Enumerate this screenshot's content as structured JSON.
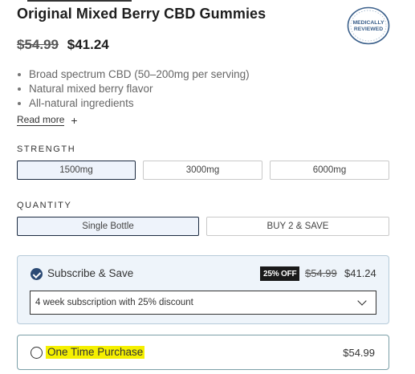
{
  "product": {
    "title": "Original Mixed Berry CBD Gummies",
    "price_original": "$54.99",
    "price_sale": "$41.24",
    "badge_text_line1": "MEDICALLY",
    "badge_text_line2": "REVIEWED",
    "features": [
      "Broad spectrum CBD (50–200mg per serving)",
      "Natural mixed berry flavor",
      "All-natural ingredients"
    ],
    "read_more_label": "Read more"
  },
  "strength": {
    "label": "STRENGTH",
    "options": [
      "1500mg",
      "3000mg",
      "6000mg"
    ],
    "selected": "1500mg"
  },
  "quantity": {
    "label": "QUANTITY",
    "options": [
      "Single Bottle",
      "BUY 2 & SAVE"
    ],
    "selected": "Single Bottle"
  },
  "subscribe": {
    "title": "Subscribe & Save",
    "discount_badge": "25% OFF",
    "price_original": "$54.99",
    "price_sale": "$41.24",
    "frequency_selected": "4 week subscription with 25% discount",
    "selected": true
  },
  "one_time": {
    "title": "One Time Purchase",
    "price": "$54.99",
    "selected": false
  },
  "colors": {
    "selected_border": "#1b2a40",
    "selected_fill": "#eef3fb",
    "subscribe_fill": "#eef4fa",
    "check_fill": "#2b4a75",
    "highlight": "#f5f000",
    "badge_blue": "#3a5f8a"
  }
}
